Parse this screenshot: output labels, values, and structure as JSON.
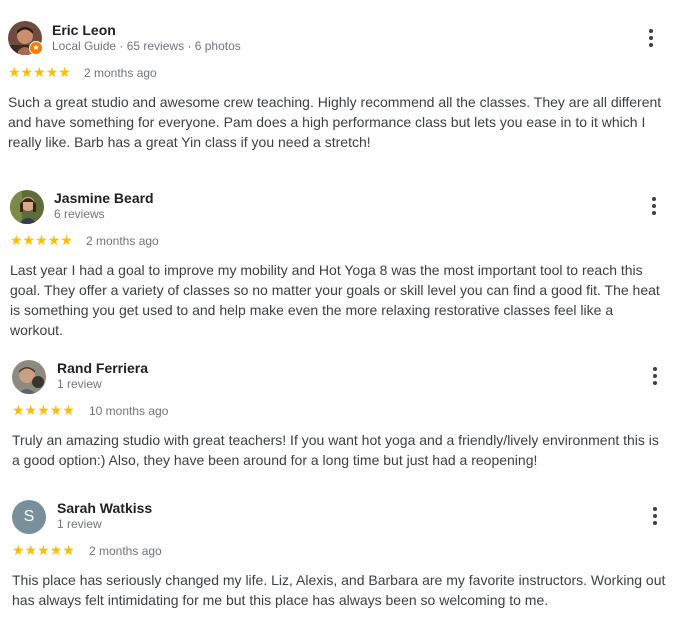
{
  "reviews": [
    {
      "name": "Eric Leon",
      "meta": "Local Guide · 65 reviews · 6 photos",
      "stars": "★★★★★",
      "rating": 5,
      "date": "2 months ago",
      "text": "Such a great studio and awesome crew teaching. Highly recommend all the classes. They are all different and have something for everyone. Pam does a high performance class but lets you ease in to it which I really like. Barb has a great Yin class if you need a stretch!"
    },
    {
      "name": "Jasmine Beard",
      "meta": "6 reviews",
      "stars": "★★★★★",
      "rating": 5,
      "date": "2 months ago",
      "text": "Last year I had a goal to improve my mobility and Hot Yoga 8 was the most important tool to reach this goal. They offer a variety of classes so no matter your goals or skill level you can find a good fit. The heat is something you get used to and help make even the more relaxing restorative classes feel like a workout."
    },
    {
      "name": "Rand Ferriera",
      "meta": "1 review",
      "stars": "★★★★★",
      "rating": 5,
      "date": "10 months ago",
      "text": "Truly an amazing studio with great teachers! If you want hot yoga and a friendly/lively environment this is a good option:) Also, they have been around for a long time but just had a reopening!"
    },
    {
      "name": "Sarah Watkiss",
      "avatar_letter": "S",
      "meta": "1 review",
      "stars": "★★★★★",
      "rating": 5,
      "date": "2 months ago",
      "text": "This place has seriously changed my life. Liz, Alexis, and Barbara are my favorite instructors. Working out has always felt intimidating for me but this place has always been so welcoming to me."
    }
  ],
  "colors": {
    "star": "#fbbc04",
    "meta_text": "#70757a",
    "local_guide_badge": "#f57c00",
    "letter_avatar_bg": "#78909c"
  },
  "icons": {
    "more": "more-vert-icon",
    "local_guide": "local-guide-badge-icon"
  }
}
